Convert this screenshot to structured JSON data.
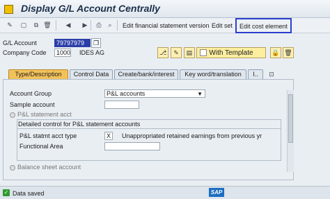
{
  "title": "Display G/L Account Centrally",
  "toolbar": {
    "edit_fs_version": "Edit financial statement version",
    "edit_set": "Edit set",
    "edit_cost_element": "Edit cost element"
  },
  "header": {
    "gl_account_label": "G/L Account",
    "gl_account_value": "79797979",
    "company_code_label": "Company Code",
    "company_code_value": "1000",
    "company_name": "IDES AG",
    "with_template_label": "With Template"
  },
  "tabs": [
    {
      "label": "Type/Description"
    },
    {
      "label": "Control Data"
    },
    {
      "label": "Create/bank/interest"
    },
    {
      "label": "Key word/translation"
    },
    {
      "label": "I.."
    }
  ],
  "panel": {
    "account_group_label": "Account Group",
    "account_group_value": "P&L accounts",
    "sample_account_label": "Sample account",
    "pl_statement_acct_label": "P&L statement acct",
    "group_title": "Detailed control for P&L statement accounts",
    "pl_statmt_type_label": "P&L statmt acct type",
    "pl_statmt_type_value": "X",
    "pl_statmt_type_desc": "Unappropriated retained earnings from previous yr",
    "functional_area_label": "Functional Area",
    "balance_sheet_label": "Balance sheet account"
  },
  "status": {
    "message": "Data saved",
    "logo": "SAP"
  }
}
